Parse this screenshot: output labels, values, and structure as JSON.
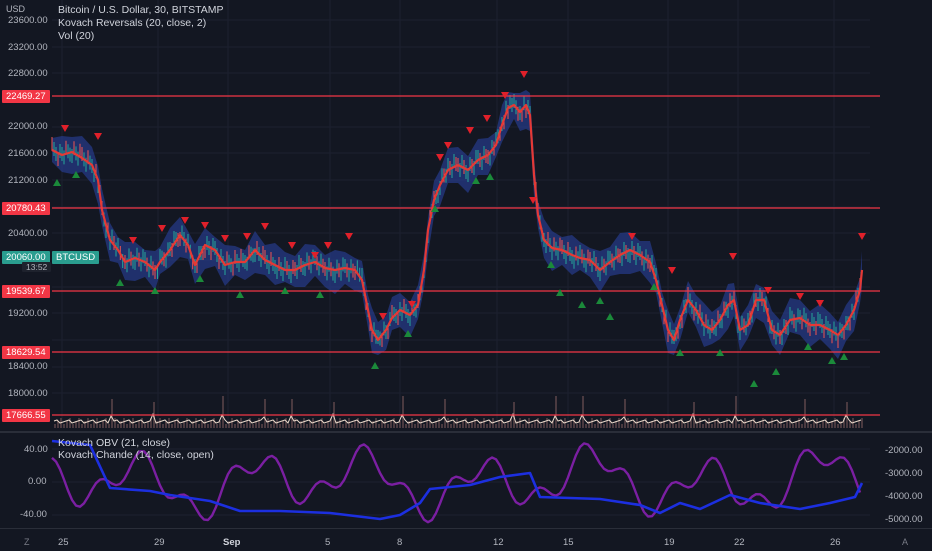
{
  "legend": {
    "title": "Bitcoin / U.S. Dollar, 30, BITSTAMP",
    "indicator1": "Kovach Reversals (20, close, 2)",
    "indicator2": "Vol (20)",
    "sub_indicator1": "Kovach OBV (21, close)",
    "sub_indicator2": "Kovach Chande (14, close, open)"
  },
  "axis": {
    "currency": "USD",
    "price_ticks": [
      "23600.00",
      "23200.00",
      "22800.00",
      "22000.00",
      "21600.00",
      "21200.00",
      "20400.00",
      "19200.00",
      "18400.00",
      "18000.00"
    ],
    "osc_ticks_left": [
      "40.00",
      "0.00",
      "-40.00"
    ],
    "osc_ticks_right": [
      "-2000.00",
      "-3000.00",
      "-4000.00",
      "-5000.00"
    ],
    "dates": [
      "25",
      "29",
      "Sep",
      "5",
      "8",
      "12",
      "15",
      "19",
      "22",
      "26"
    ]
  },
  "levels": [
    "22469.27",
    "20780.43",
    "19539.67",
    "18629.54",
    "17666.55"
  ],
  "current": {
    "price": "20060.00",
    "symbol": "BTCUSD",
    "countdown": "13:52"
  },
  "corner": {
    "left": "Z",
    "right": "A"
  },
  "colors": {
    "bg": "#131722",
    "level_line": "#f23645",
    "price_line": "#e53935",
    "band": "#2a3d8f",
    "candle_up": "#26a69a",
    "candle_down": "#ef5350",
    "arrow_up": "#1b8a3a",
    "arrow_down": "#e0202a",
    "obv": "#1c2fe0",
    "chande": "#7b1fa2"
  }
}
